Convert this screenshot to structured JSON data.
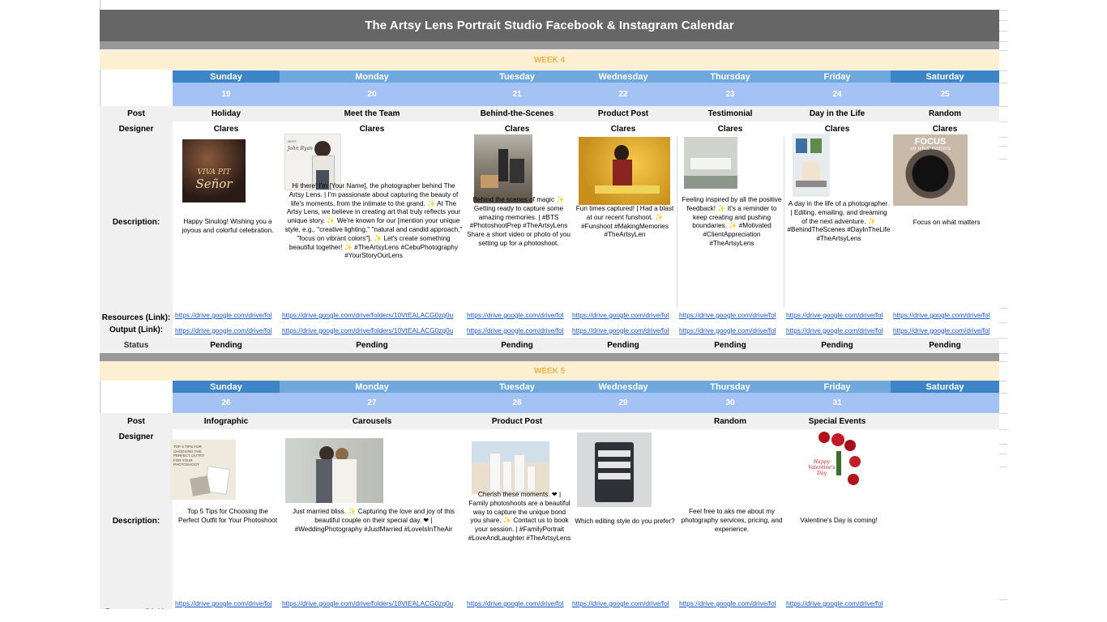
{
  "title": "The Artsy Lens Portrait Studio Facebook & Instagram Calendar",
  "colors": {
    "header_gray": "#666666",
    "week_band": "#fdf0d2",
    "week_text": "#f0b24c",
    "day_dark": "#3d85c6",
    "day_light": "#6fa8dc",
    "date_row": "#a4c2f4",
    "link": "#1a56c8"
  },
  "labels": {
    "post": "Post",
    "designer": "Designer",
    "description": "Description:",
    "resources": "Resources (Link):",
    "output": "Output (Link):",
    "status": "Status"
  },
  "days": [
    "Sunday",
    "Monday",
    "Tuesday",
    "Wednesday",
    "Thursday",
    "Friday",
    "Saturday"
  ],
  "week4": {
    "label": "WEEK 4",
    "dates": [
      "19",
      "20",
      "21",
      "22",
      "23",
      "24",
      "25"
    ],
    "posts": [
      "Holiday",
      "Meet the Team",
      "Behind-the-Scenes",
      "Product Post",
      "Testimonial",
      "Day in the Life",
      "Random"
    ],
    "designers": [
      "Clares",
      "Clares",
      "Clares",
      "Clares",
      "Clares",
      "Clares",
      "Clares"
    ],
    "descriptions": [
      "Happy Sinulog! Wishing you a joyous and colorful celebration.",
      "Hi there! I'm [Your Name], the photographer behind The Artsy Lens. | I'm passionate about capturing the beauty of life's moments, from the intimate to the grand. ✨ At The Artsy Lens, we believe in creating art that truly reflects your unique story. ✨ We're known for our [mention your unique style, e.g., \"creative lighting,\" \"natural and candid approach,\" \"focus on vibrant colors\"]. ✨ Let's create something beautiful together! ✨ #TheArtsyLens #CebuPhotography #YourStoryOurLens",
      "Behind the scenes of magic ✨ Getting ready to capture some amazing memories. | #BTS #PhotoshootPrep #TheArtsyLens        Share a short video or photo of you setting up for a photoshoot.",
      "Fun times captured! | Had a blast at our recent funshoot. ✨ #Funshoot #MakingMemories #TheArtsyLen",
      "Feeling inspired by all the positive feedback! ✨ It's a reminder to keep creating and pushing boundaries. ✨ #Motivated #ClientAppreciation #TheArtsyLens",
      "A day in the life of a photographer. | Editing, emailing, and dreaming of the next adventure. ✨ #BehindTheScenes #DayInTheLife #TheArtsyLens",
      "Focus on what matters"
    ],
    "resources": [
      "https://drive.google.com/drive/fol",
      "https://drive.google.com/drive/folders/10VtEALACG0zq0u",
      "https://drive.google.com/drive/fol",
      "https://drive.google.com/drive/fol",
      "https://drive.google.com/drive/fol",
      "https://drive.google.com/drive/fol",
      "https://drive.google.com/drive/fol"
    ],
    "outputs": [
      "https://drive.google.com/drive/fol",
      "https://drive.google.com/drive/folders/10VtEALACG0zq0u",
      "https://drive.google.com/drive/fol",
      "https://drive.google.com/drive/fol",
      "https://drive.google.com/drive/fol",
      "https://drive.google.com/drive/fol",
      "https://drive.google.com/drive/fol"
    ],
    "status": [
      "Pending",
      "Pending",
      "Pending",
      "Pending",
      "Pending",
      "Pending",
      "Pending"
    ]
  },
  "week5": {
    "label": "WEEK 5",
    "dates": [
      "26",
      "27",
      "28",
      "29",
      "30",
      "31",
      ""
    ],
    "posts": [
      "Infographic",
      "Carousels",
      "Product Post",
      "",
      "Random",
      "Special Events",
      ""
    ],
    "descriptions": [
      "Top 5 Tips for Choosing the Perfect Outfit for Your Photoshoot",
      "Just married bliss. ✨ Capturing the love and joy of this beautiful couple on their special day. ❤ | #WeddingPhotography #JustMarried #LoveIsInTheAir",
      "Cherish these moments. ❤ | Family photoshoots are a beautiful way to capture the unique bond you share. ✨ Contact us to book your session. | #FamilyPortrait #LoveAndLaughter #TheArtsyLens",
      "Which editing style do you prefer?",
      "Feel free to aks me about my photography services, pricing, and experience.",
      "Valentine's Day is coming!",
      ""
    ],
    "resources": [
      "https://drive.google.com/drive/fol",
      "https://drive.google.com/drive/folders/10VtEALACG0zq0u",
      "https://drive.google.com/drive/fol",
      "https://drive.google.com/drive/fol",
      "https://drive.google.com/drive/fol",
      "https://drive.google.com/drive/fol",
      ""
    ]
  },
  "image_text": {
    "vivapit": "VIVA PIT",
    "senyor": "Señor",
    "focus": "FOCUS",
    "focus_sub": "on what matters",
    "meet": "MEET",
    "meet_name": "John Ryan",
    "tips": "TOP 5 TIPS FOR CHOOSING THE PERFECT OUTFIT FOR YOUR PHOTOSHOOT",
    "valentine": "Happy Valentine's Day"
  }
}
